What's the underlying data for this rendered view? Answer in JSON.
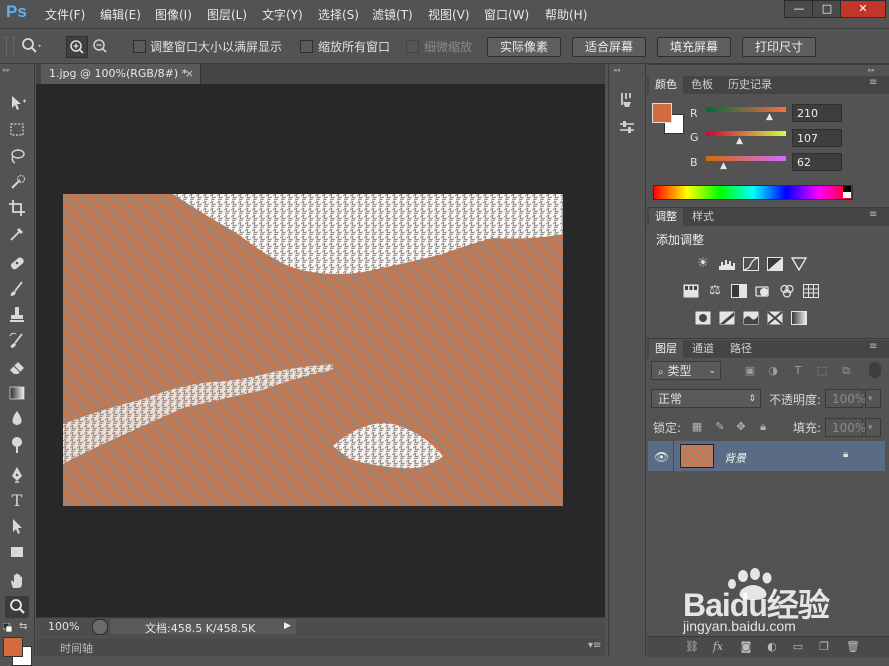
{
  "app": {
    "logo": "Ps"
  },
  "menu": [
    "文件(F)",
    "编辑(E)",
    "图像(I)",
    "图层(L)",
    "文字(Y)",
    "选择(S)",
    "滤镜(T)",
    "视图(V)",
    "窗口(W)",
    "帮助(H)"
  ],
  "window_controls": {
    "minimize": "—",
    "maximize": "□",
    "close": "✕"
  },
  "options": {
    "resize_windows": "调整窗口大小以满屏显示",
    "zoom_all": "缩放所有窗口",
    "scrubby_zoom": "细微缩放",
    "actual_pixels": "实际像素",
    "fit_screen": "适合屏幕",
    "fill_screen": "填充屏幕",
    "print_size": "打印尺寸"
  },
  "document": {
    "tab_title": "1.jpg @ 100%(RGB/8#) *",
    "close": "×",
    "zoom": "100%",
    "doc_size": "文档:458.5 K/458.5K",
    "timeline_label": "时间轴"
  },
  "color_panel": {
    "tabs": [
      "颜色",
      "色板",
      "历史记录"
    ],
    "r_label": "R",
    "g_label": "G",
    "b_label": "B",
    "r": "210",
    "g": "107",
    "b": "62",
    "fg_color": "#d26b3e",
    "bg_color": "#ffffff"
  },
  "adjust_panel": {
    "tabs": [
      "调整",
      "样式"
    ],
    "title": "添加调整"
  },
  "layers_panel": {
    "tabs": [
      "图层",
      "通道",
      "路径"
    ],
    "filter_label": "类型",
    "blend_mode": "正常",
    "opacity_label": "不透明度:",
    "opacity_value": "100%",
    "lock_label": "锁定:",
    "fill_label": "填充:",
    "fill_value": "100%",
    "layer_name": "背景"
  },
  "watermark": {
    "brand": "Baidu经验",
    "url": "jingyan.baidu.com"
  }
}
